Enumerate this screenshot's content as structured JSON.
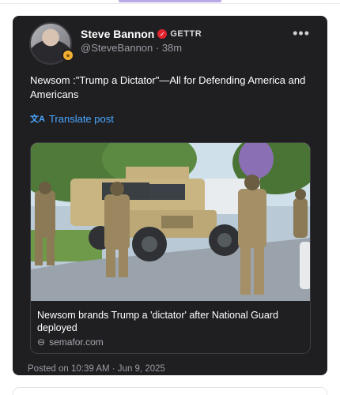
{
  "post": {
    "author": {
      "name": "Steve Bannon",
      "handle": "@SteveBannon",
      "time": "38m",
      "platform": "GETTR"
    },
    "text": "Newsom :\"Trump a Dictator\"—All for Defending America and Americans",
    "translate_label": "Translate post",
    "link": {
      "title": "Newsom brands Trump a 'dictator' after National Guard deployed",
      "domain": "semafor.com"
    },
    "posted_on": "Posted on 10:39 AM · Jun 9, 2025",
    "more_label": "•••"
  },
  "colors": {
    "card_bg": "#1f1f22",
    "accent_link": "#4aa8ff",
    "verified": "#e0242f"
  },
  "icons": [
    "verified-icon",
    "more-icon",
    "translate-icon",
    "link-icon",
    "avatar-badge-icon"
  ]
}
